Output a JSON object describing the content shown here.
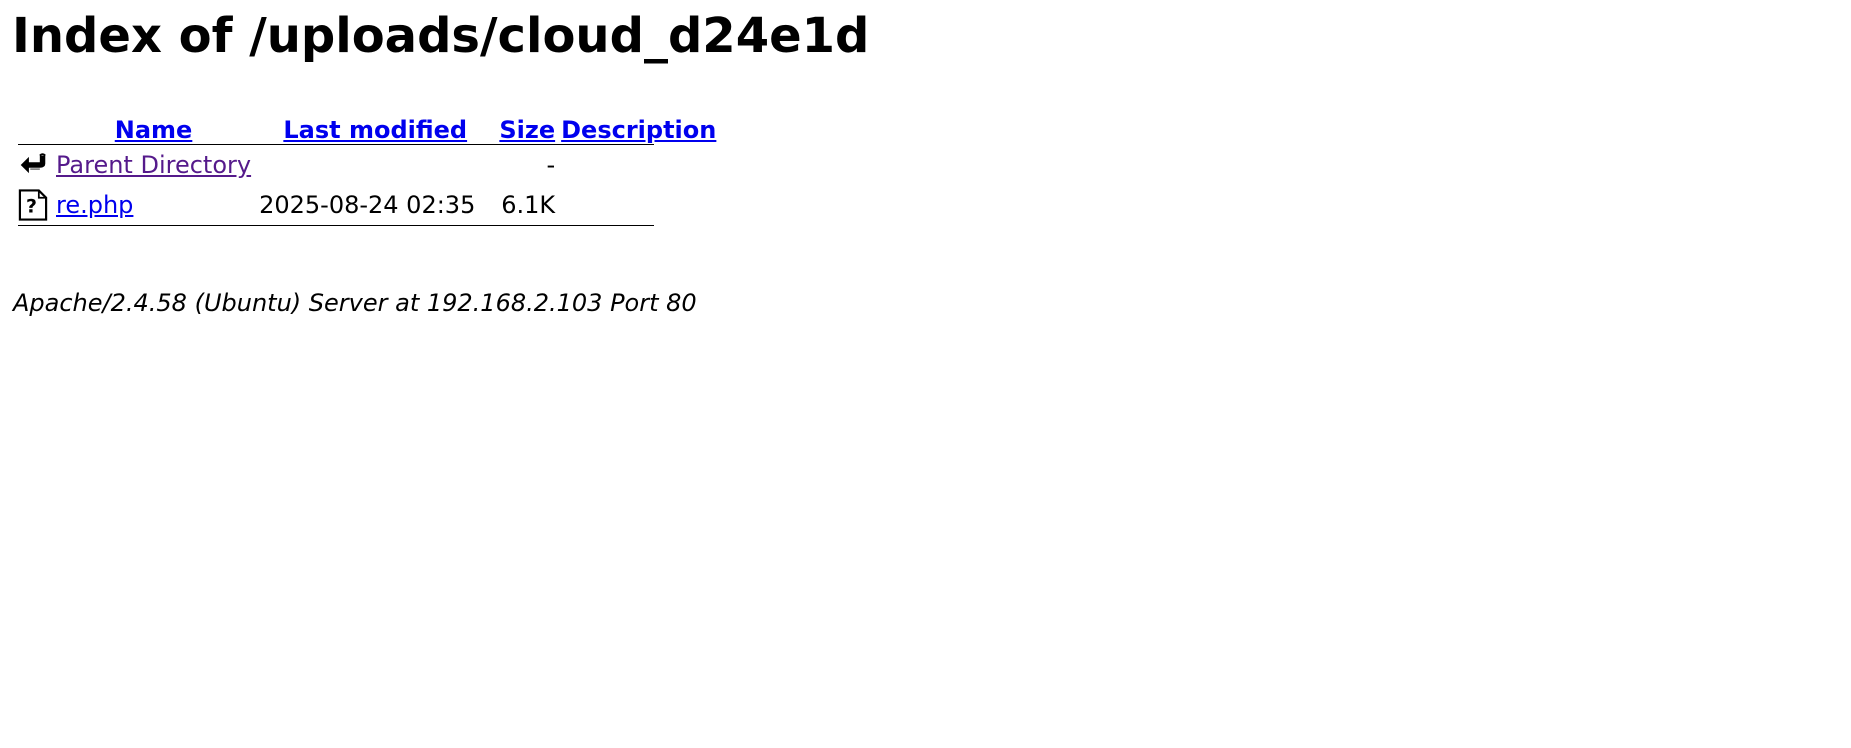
{
  "page": {
    "title": "Index of /uploads/cloud_d24e1d",
    "footer": "Apache/2.4.58 (Ubuntu) Server at 192.168.2.103 Port 80"
  },
  "table": {
    "headers": {
      "name": "Name",
      "last_modified": "Last modified",
      "size": "Size",
      "description": "Description"
    },
    "rows": [
      {
        "icon": "back-arrow-icon",
        "name": "Parent Directory",
        "last_modified": "",
        "size": "-",
        "description": ""
      },
      {
        "icon": "unknown-file-icon",
        "name": "re.php",
        "last_modified": "2025-08-24 02:35",
        "size": "6.1K",
        "description": ""
      }
    ]
  },
  "colors": {
    "link": "#0000ee",
    "visited_link": "#551a8b",
    "text": "#000000",
    "background": "#ffffff"
  }
}
